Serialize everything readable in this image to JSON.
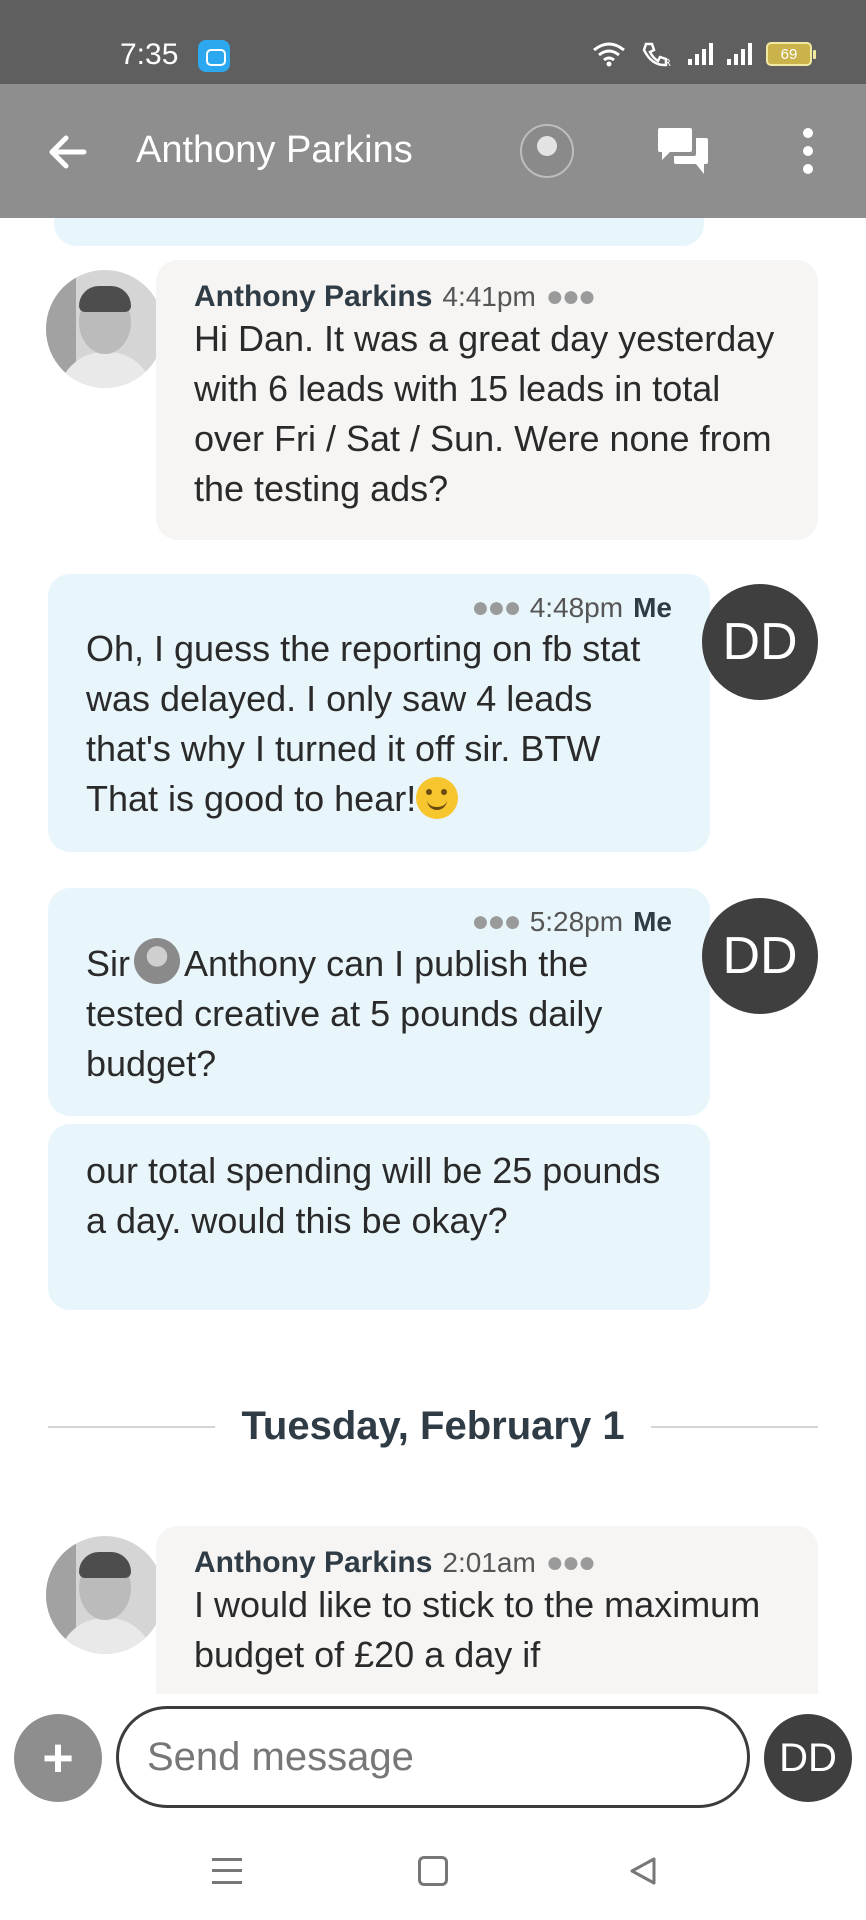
{
  "status_bar": {
    "time": "7:35",
    "battery": "69"
  },
  "header": {
    "title": "Anthony Parkins",
    "icons": [
      "back-arrow-icon",
      "contact-avatar",
      "chat-bubbles-icon",
      "more-vertical-icon"
    ]
  },
  "messages": [
    {
      "sender": "Anthony Parkins",
      "time": "4:41pm",
      "text": "Hi Dan. It was a great day yesterday with 6 leads with 15 leads in total over Fri / Sat / Sun. Were none from the testing ads?"
    },
    {
      "sender": "Me",
      "time": "4:48pm",
      "text": "Oh, I guess the reporting on fb stat was delayed. I only saw 4 leads that's why I turned it off sir. BTW That is good to hear!",
      "emoji": "smiling-face-emoji"
    },
    {
      "sender": "Me",
      "time": "5:28pm",
      "text_before": "Sir",
      "text_after": "Anthony can I publish the tested creative at 5 pounds daily budget?"
    },
    {
      "sender": "Me",
      "text": "our total spending will be 25 pounds a day. would this be okay?"
    },
    {
      "sender": "Anthony Parkins",
      "time": "2:01am",
      "text": "I would like to stick to the maximum budget of £20 a day if"
    }
  ],
  "date_divider": "Tuesday, February 1",
  "me_initials": "DD",
  "composer": {
    "placeholder": "Send message",
    "add_label": "+",
    "avatar_initials": "DD"
  },
  "colors": {
    "header_bg": "#8e8e8e",
    "status_bg": "#5f5f5f",
    "incoming_bubble": "#f6f5f3",
    "outgoing_bubble": "#e8f6fb",
    "me_avatar": "#3f3f3f"
  }
}
